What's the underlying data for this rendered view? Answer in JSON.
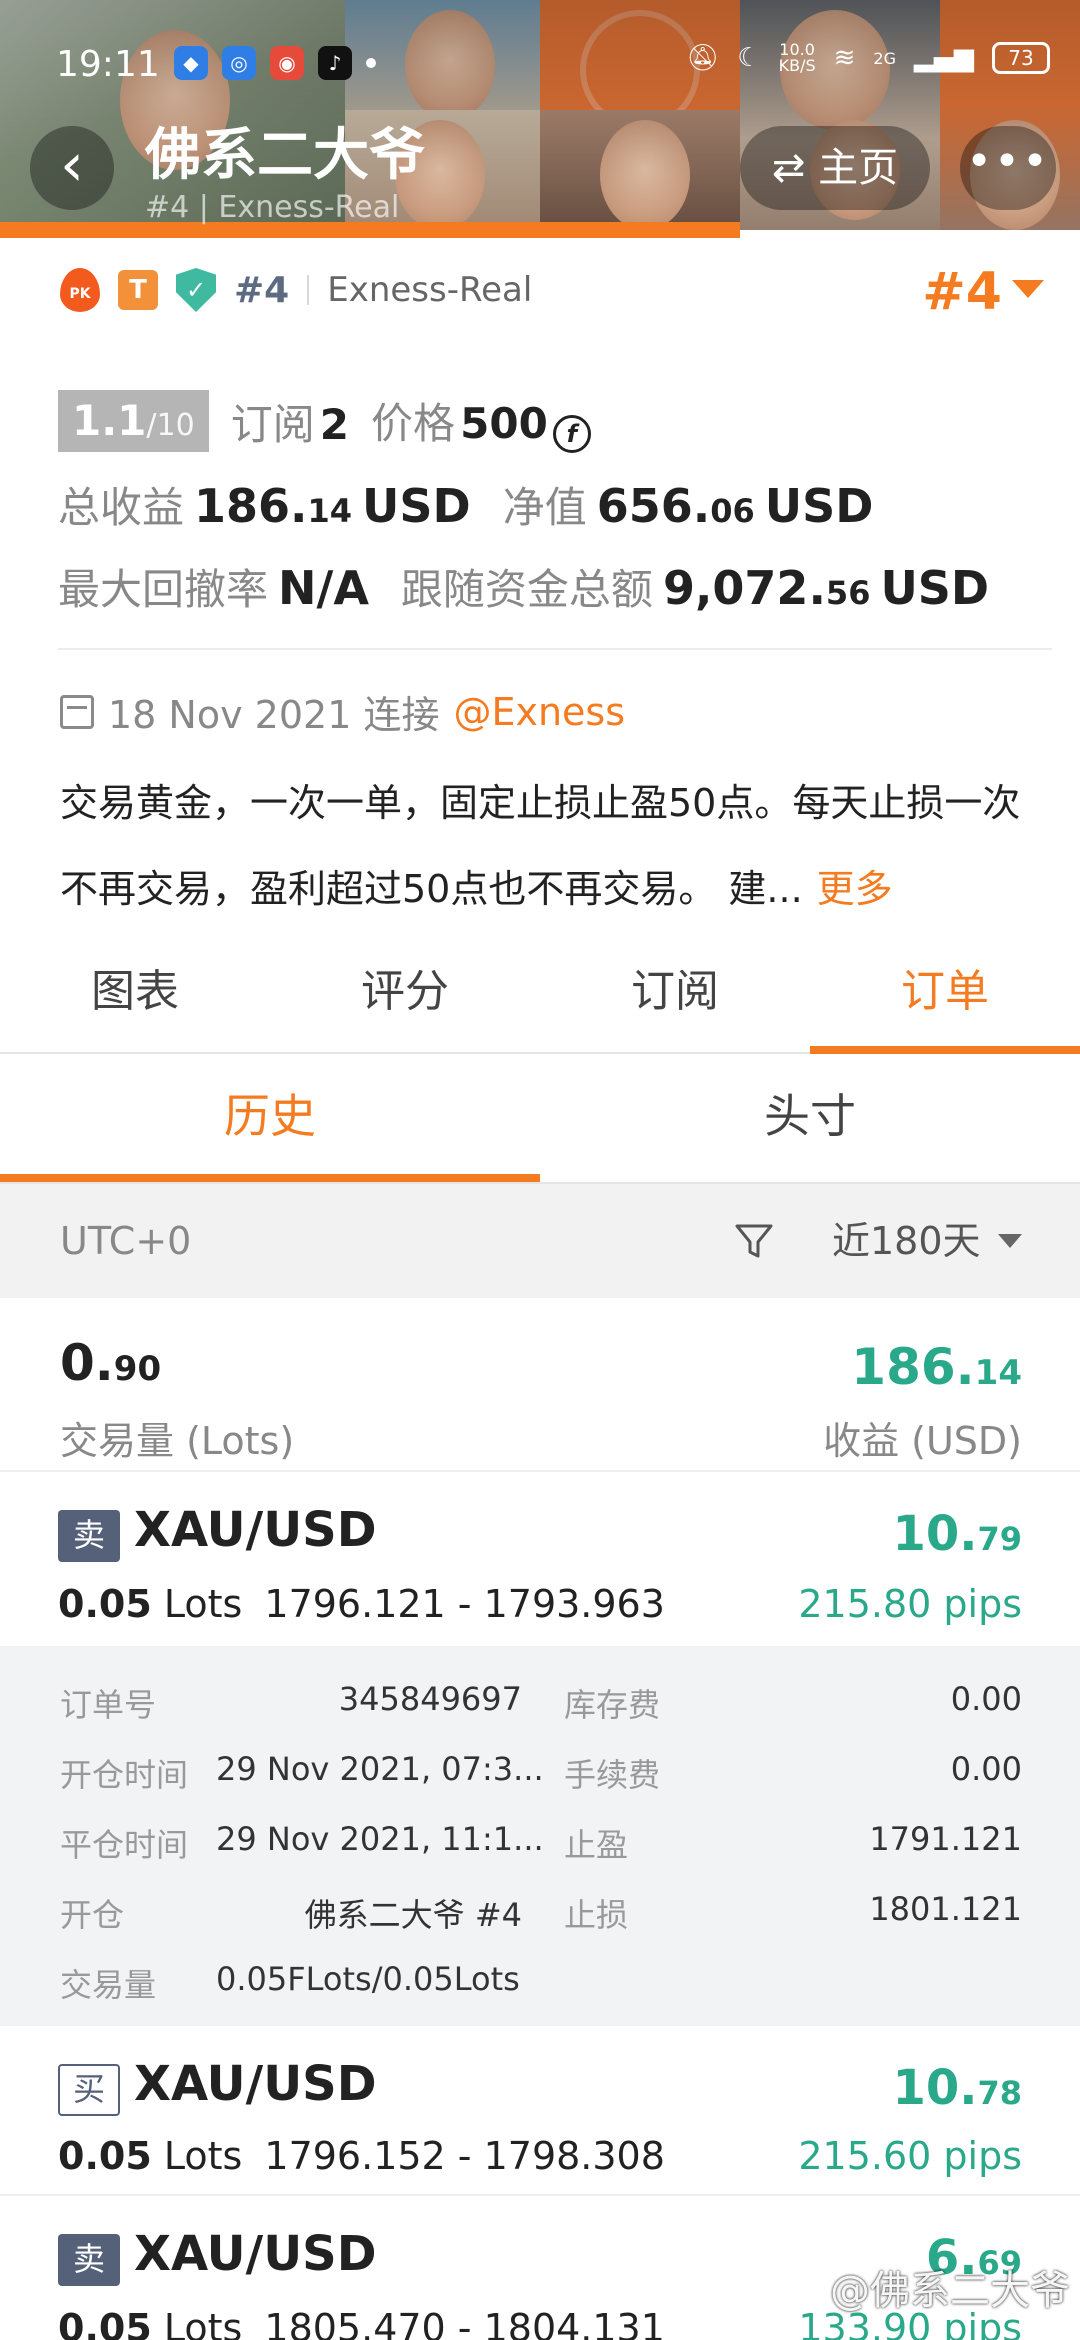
{
  "status_bar": {
    "time": "19:11",
    "net_speed": "10.0\nKB/S",
    "signal": "2G",
    "battery": "73"
  },
  "nav": {
    "title": "佛系二大爷",
    "subtitle": "#4 | Exness-Real",
    "home_label": "⇄ 主页",
    "more_label": "•••"
  },
  "profile": {
    "pk_badge": "PK",
    "t_badge": "T",
    "rank": "#4",
    "broker": "Exness-Real",
    "rank_big": "#4",
    "score": "1.1",
    "score_den": "/10",
    "subscribe_label": "订阅",
    "subscribe_count": "2",
    "price_label": "价格",
    "price_value": "500",
    "price_icon": "f",
    "total_profit_label": "总收益",
    "total_profit_int": "186.",
    "total_profit_dec": "14",
    "total_profit_unit": "USD",
    "equity_label": "净值",
    "equity_int": "656.",
    "equity_dec": "06",
    "equity_unit": "USD",
    "drawdown_label": "最大回撤率",
    "drawdown_value": "N/A",
    "follow_label": "跟随资金总额",
    "follow_int": "9,072.",
    "follow_dec": "56",
    "follow_unit": "USD",
    "date_text": "18 Nov 2021 连接",
    "broker_link": "@Exness",
    "description": "交易黄金，一次一单，固定止损止盈50点。每天止损一次不再交易，盈利超过50点也不再交易。 建...",
    "more_label": "更多"
  },
  "tabs": [
    {
      "label": "图表"
    },
    {
      "label": "评分"
    },
    {
      "label": "订阅"
    },
    {
      "label": "订单"
    }
  ],
  "subtabs": [
    {
      "label": "历史"
    },
    {
      "label": "头寸"
    }
  ],
  "filter": {
    "timezone": "UTC+0",
    "range": "近180天"
  },
  "summary": {
    "lots_int": "0.",
    "lots_dec": "90",
    "lots_label": "交易量 (Lots)",
    "profit_int": "186.",
    "profit_dec": "14",
    "profit_label": "收益 (USD)"
  },
  "orders": [
    {
      "side": "卖",
      "symbol": "XAU/USD",
      "lots": "0.05",
      "lots_unit": "Lots",
      "range": "1796.121 - 1793.963",
      "profit_int": "10.",
      "profit_dec": "79",
      "pips": "215.80 pips",
      "details": {
        "order_no_label": "订单号",
        "order_no": "345849697",
        "swap_label": "库存费",
        "swap": "0.00",
        "open_time_label": "开仓时间",
        "open_time": "29 Nov 2021, 07:3...",
        "fee_label": "手续费",
        "fee": "0.00",
        "close_time_label": "平仓时间",
        "close_time": "29 Nov 2021, 11:1...",
        "tp_label": "止盈",
        "tp": "1791.121",
        "open_label": "开仓",
        "open": "佛系二大爷  #4",
        "sl_label": "止损",
        "sl": "1801.121",
        "volume_label": "交易量",
        "volume": "0.05FLots/0.05Lots"
      }
    },
    {
      "side": "买",
      "symbol": "XAU/USD",
      "lots": "0.05",
      "lots_unit": "Lots",
      "range": "1796.152 - 1798.308",
      "profit_int": "10.",
      "profit_dec": "78",
      "pips": "215.60 pips"
    },
    {
      "side": "卖",
      "symbol": "XAU/USD",
      "lots": "0.05",
      "lots_unit": "Lots",
      "range": "1805.470 - 1804.131",
      "profit_int": "6.",
      "profit_dec": "69",
      "pips": "133.90 pips"
    }
  ],
  "watermark": "@佛系二大爷",
  "colors": {
    "accent": "#f47b20",
    "profit": "#2aa88a",
    "side_badge": "#546178"
  }
}
